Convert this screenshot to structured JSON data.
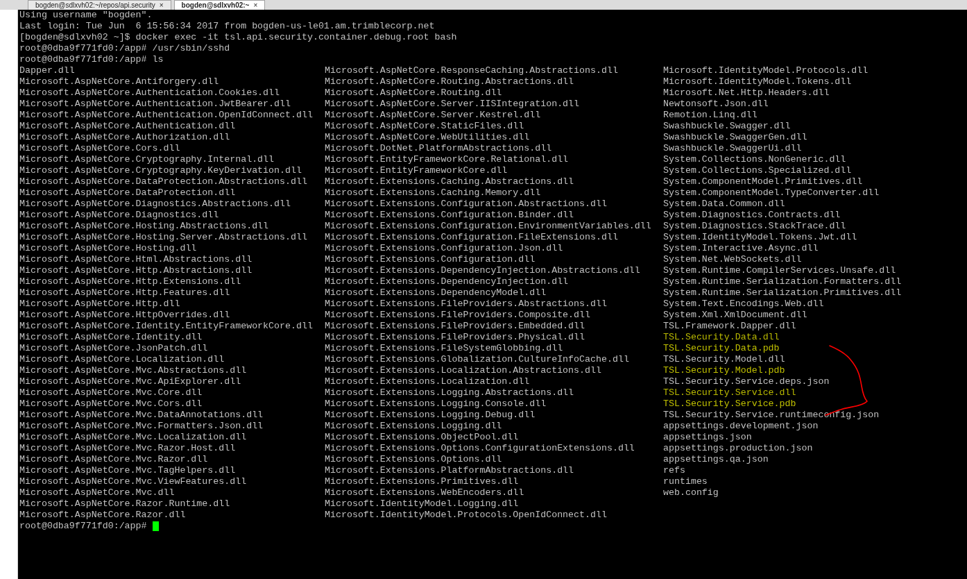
{
  "tabs": [
    {
      "label": "bogden@sdlxvh02:~/repos/api.security",
      "close": "×",
      "selected": false
    },
    {
      "label": "bogden@sdlxvh02:~",
      "close": "×",
      "selected": true
    }
  ],
  "terminal": {
    "lines": [
      "Using username \"bogden\".",
      "Last login: Tue Jun  6 15:56:34 2017 from bogden-us-le01.am.trimblecorp.net",
      "[bogden@sdlxvh02 ~]$ docker exec -it tsl.api.security.container.debug.root bash",
      "root@0dba9f771fd0:/app# /usr/sbin/sshd",
      "root@0dba9f771fd0:/app# ls"
    ],
    "listing": [
      [
        {
          "name": "Dapper.dll",
          "color": "#c0c0c0"
        },
        {
          "name": "Microsoft.AspNetCore.Antiforgery.dll",
          "color": "#c0c0c0"
        },
        {
          "name": "Microsoft.AspNetCore.Authentication.Cookies.dll",
          "color": "#c0c0c0"
        },
        {
          "name": "Microsoft.AspNetCore.Authentication.JwtBearer.dll",
          "color": "#c0c0c0"
        },
        {
          "name": "Microsoft.AspNetCore.Authentication.OpenIdConnect.dll",
          "color": "#c0c0c0"
        },
        {
          "name": "Microsoft.AspNetCore.Authentication.dll",
          "color": "#c0c0c0"
        },
        {
          "name": "Microsoft.AspNetCore.Authorization.dll",
          "color": "#c0c0c0"
        },
        {
          "name": "Microsoft.AspNetCore.Cors.dll",
          "color": "#c0c0c0"
        },
        {
          "name": "Microsoft.AspNetCore.Cryptography.Internal.dll",
          "color": "#c0c0c0"
        },
        {
          "name": "Microsoft.AspNetCore.Cryptography.KeyDerivation.dll",
          "color": "#c0c0c0"
        },
        {
          "name": "Microsoft.AspNetCore.DataProtection.Abstractions.dll",
          "color": "#c0c0c0"
        },
        {
          "name": "Microsoft.AspNetCore.DataProtection.dll",
          "color": "#c0c0c0"
        },
        {
          "name": "Microsoft.AspNetCore.Diagnostics.Abstractions.dll",
          "color": "#c0c0c0"
        },
        {
          "name": "Microsoft.AspNetCore.Diagnostics.dll",
          "color": "#c0c0c0"
        },
        {
          "name": "Microsoft.AspNetCore.Hosting.Abstractions.dll",
          "color": "#c0c0c0"
        },
        {
          "name": "Microsoft.AspNetCore.Hosting.Server.Abstractions.dll",
          "color": "#c0c0c0"
        },
        {
          "name": "Microsoft.AspNetCore.Hosting.dll",
          "color": "#c0c0c0"
        },
        {
          "name": "Microsoft.AspNetCore.Html.Abstractions.dll",
          "color": "#c0c0c0"
        },
        {
          "name": "Microsoft.AspNetCore.Http.Abstractions.dll",
          "color": "#c0c0c0"
        },
        {
          "name": "Microsoft.AspNetCore.Http.Extensions.dll",
          "color": "#c0c0c0"
        },
        {
          "name": "Microsoft.AspNetCore.Http.Features.dll",
          "color": "#c0c0c0"
        },
        {
          "name": "Microsoft.AspNetCore.Http.dll",
          "color": "#c0c0c0"
        },
        {
          "name": "Microsoft.AspNetCore.HttpOverrides.dll",
          "color": "#c0c0c0"
        },
        {
          "name": "Microsoft.AspNetCore.Identity.EntityFrameworkCore.dll",
          "color": "#c0c0c0"
        },
        {
          "name": "Microsoft.AspNetCore.Identity.dll",
          "color": "#c0c0c0"
        },
        {
          "name": "Microsoft.AspNetCore.JsonPatch.dll",
          "color": "#c0c0c0"
        },
        {
          "name": "Microsoft.AspNetCore.Localization.dll",
          "color": "#c0c0c0"
        },
        {
          "name": "Microsoft.AspNetCore.Mvc.Abstractions.dll",
          "color": "#c0c0c0"
        },
        {
          "name": "Microsoft.AspNetCore.Mvc.ApiExplorer.dll",
          "color": "#c0c0c0"
        },
        {
          "name": "Microsoft.AspNetCore.Mvc.Core.dll",
          "color": "#c0c0c0"
        },
        {
          "name": "Microsoft.AspNetCore.Mvc.Cors.dll",
          "color": "#c0c0c0"
        },
        {
          "name": "Microsoft.AspNetCore.Mvc.DataAnnotations.dll",
          "color": "#c0c0c0"
        },
        {
          "name": "Microsoft.AspNetCore.Mvc.Formatters.Json.dll",
          "color": "#c0c0c0"
        },
        {
          "name": "Microsoft.AspNetCore.Mvc.Localization.dll",
          "color": "#c0c0c0"
        },
        {
          "name": "Microsoft.AspNetCore.Mvc.Razor.Host.dll",
          "color": "#c0c0c0"
        },
        {
          "name": "Microsoft.AspNetCore.Mvc.Razor.dll",
          "color": "#c0c0c0"
        },
        {
          "name": "Microsoft.AspNetCore.Mvc.TagHelpers.dll",
          "color": "#c0c0c0"
        },
        {
          "name": "Microsoft.AspNetCore.Mvc.ViewFeatures.dll",
          "color": "#c0c0c0"
        },
        {
          "name": "Microsoft.AspNetCore.Mvc.dll",
          "color": "#c0c0c0"
        },
        {
          "name": "Microsoft.AspNetCore.Razor.Runtime.dll",
          "color": "#c0c0c0"
        },
        {
          "name": "Microsoft.AspNetCore.Razor.dll",
          "color": "#c0c0c0"
        }
      ],
      [
        {
          "name": "Microsoft.AspNetCore.ResponseCaching.Abstractions.dll",
          "color": "#c0c0c0"
        },
        {
          "name": "Microsoft.AspNetCore.Routing.Abstractions.dll",
          "color": "#c0c0c0"
        },
        {
          "name": "Microsoft.AspNetCore.Routing.dll",
          "color": "#c0c0c0"
        },
        {
          "name": "Microsoft.AspNetCore.Server.IISIntegration.dll",
          "color": "#c0c0c0"
        },
        {
          "name": "Microsoft.AspNetCore.Server.Kestrel.dll",
          "color": "#c0c0c0"
        },
        {
          "name": "Microsoft.AspNetCore.StaticFiles.dll",
          "color": "#c0c0c0"
        },
        {
          "name": "Microsoft.AspNetCore.WebUtilities.dll",
          "color": "#c0c0c0"
        },
        {
          "name": "Microsoft.DotNet.PlatformAbstractions.dll",
          "color": "#c0c0c0"
        },
        {
          "name": "Microsoft.EntityFrameworkCore.Relational.dll",
          "color": "#c0c0c0"
        },
        {
          "name": "Microsoft.EntityFrameworkCore.dll",
          "color": "#c0c0c0"
        },
        {
          "name": "Microsoft.Extensions.Caching.Abstractions.dll",
          "color": "#c0c0c0"
        },
        {
          "name": "Microsoft.Extensions.Caching.Memory.dll",
          "color": "#c0c0c0"
        },
        {
          "name": "Microsoft.Extensions.Configuration.Abstractions.dll",
          "color": "#c0c0c0"
        },
        {
          "name": "Microsoft.Extensions.Configuration.Binder.dll",
          "color": "#c0c0c0"
        },
        {
          "name": "Microsoft.Extensions.Configuration.EnvironmentVariables.dll",
          "color": "#c0c0c0"
        },
        {
          "name": "Microsoft.Extensions.Configuration.FileExtensions.dll",
          "color": "#c0c0c0"
        },
        {
          "name": "Microsoft.Extensions.Configuration.Json.dll",
          "color": "#c0c0c0"
        },
        {
          "name": "Microsoft.Extensions.Configuration.dll",
          "color": "#c0c0c0"
        },
        {
          "name": "Microsoft.Extensions.DependencyInjection.Abstractions.dll",
          "color": "#c0c0c0"
        },
        {
          "name": "Microsoft.Extensions.DependencyInjection.dll",
          "color": "#c0c0c0"
        },
        {
          "name": "Microsoft.Extensions.DependencyModel.dll",
          "color": "#c0c0c0"
        },
        {
          "name": "Microsoft.Extensions.FileProviders.Abstractions.dll",
          "color": "#c0c0c0"
        },
        {
          "name": "Microsoft.Extensions.FileProviders.Composite.dll",
          "color": "#c0c0c0"
        },
        {
          "name": "Microsoft.Extensions.FileProviders.Embedded.dll",
          "color": "#c0c0c0"
        },
        {
          "name": "Microsoft.Extensions.FileProviders.Physical.dll",
          "color": "#c0c0c0"
        },
        {
          "name": "Microsoft.Extensions.FileSystemGlobbing.dll",
          "color": "#c0c0c0"
        },
        {
          "name": "Microsoft.Extensions.Globalization.CultureInfoCache.dll",
          "color": "#c0c0c0"
        },
        {
          "name": "Microsoft.Extensions.Localization.Abstractions.dll",
          "color": "#c0c0c0"
        },
        {
          "name": "Microsoft.Extensions.Localization.dll",
          "color": "#c0c0c0"
        },
        {
          "name": "Microsoft.Extensions.Logging.Abstractions.dll",
          "color": "#c0c0c0"
        },
        {
          "name": "Microsoft.Extensions.Logging.Console.dll",
          "color": "#c0c0c0"
        },
        {
          "name": "Microsoft.Extensions.Logging.Debug.dll",
          "color": "#c0c0c0"
        },
        {
          "name": "Microsoft.Extensions.Logging.dll",
          "color": "#c0c0c0"
        },
        {
          "name": "Microsoft.Extensions.ObjectPool.dll",
          "color": "#c0c0c0"
        },
        {
          "name": "Microsoft.Extensions.Options.ConfigurationExtensions.dll",
          "color": "#c0c0c0"
        },
        {
          "name": "Microsoft.Extensions.Options.dll",
          "color": "#c0c0c0"
        },
        {
          "name": "Microsoft.Extensions.PlatformAbstractions.dll",
          "color": "#c0c0c0"
        },
        {
          "name": "Microsoft.Extensions.Primitives.dll",
          "color": "#c0c0c0"
        },
        {
          "name": "Microsoft.Extensions.WebEncoders.dll",
          "color": "#c0c0c0"
        },
        {
          "name": "Microsoft.IdentityModel.Logging.dll",
          "color": "#c0c0c0"
        },
        {
          "name": "Microsoft.IdentityModel.Protocols.OpenIdConnect.dll",
          "color": "#c0c0c0"
        }
      ],
      [
        {
          "name": "Microsoft.IdentityModel.Protocols.dll",
          "color": "#c0c0c0"
        },
        {
          "name": "Microsoft.IdentityModel.Tokens.dll",
          "color": "#c0c0c0"
        },
        {
          "name": "Microsoft.Net.Http.Headers.dll",
          "color": "#c0c0c0"
        },
        {
          "name": "Newtonsoft.Json.dll",
          "color": "#c0c0c0"
        },
        {
          "name": "Remotion.Linq.dll",
          "color": "#c0c0c0"
        },
        {
          "name": "Swashbuckle.Swagger.dll",
          "color": "#c0c0c0"
        },
        {
          "name": "Swashbuckle.SwaggerGen.dll",
          "color": "#c0c0c0"
        },
        {
          "name": "Swashbuckle.SwaggerUi.dll",
          "color": "#c0c0c0"
        },
        {
          "name": "System.Collections.NonGeneric.dll",
          "color": "#c0c0c0"
        },
        {
          "name": "System.Collections.Specialized.dll",
          "color": "#c0c0c0"
        },
        {
          "name": "System.ComponentModel.Primitives.dll",
          "color": "#c0c0c0"
        },
        {
          "name": "System.ComponentModel.TypeConverter.dll",
          "color": "#c0c0c0"
        },
        {
          "name": "System.Data.Common.dll",
          "color": "#c0c0c0"
        },
        {
          "name": "System.Diagnostics.Contracts.dll",
          "color": "#c0c0c0"
        },
        {
          "name": "System.Diagnostics.StackTrace.dll",
          "color": "#c0c0c0"
        },
        {
          "name": "System.IdentityModel.Tokens.Jwt.dll",
          "color": "#c0c0c0"
        },
        {
          "name": "System.Interactive.Async.dll",
          "color": "#c0c0c0"
        },
        {
          "name": "System.Net.WebSockets.dll",
          "color": "#c0c0c0"
        },
        {
          "name": "System.Runtime.CompilerServices.Unsafe.dll",
          "color": "#c0c0c0"
        },
        {
          "name": "System.Runtime.Serialization.Formatters.dll",
          "color": "#c0c0c0"
        },
        {
          "name": "System.Runtime.Serialization.Primitives.dll",
          "color": "#c0c0c0"
        },
        {
          "name": "System.Text.Encodings.Web.dll",
          "color": "#c0c0c0"
        },
        {
          "name": "System.Xml.XmlDocument.dll",
          "color": "#c0c0c0"
        },
        {
          "name": "TSL.Framework.Dapper.dll",
          "color": "#c0c0c0"
        },
        {
          "name": "TSL.Security.Data.dll",
          "color": "#b8b800"
        },
        {
          "name": "TSL.Security.Data.pdb",
          "color": "#c0c000"
        },
        {
          "name": "TSL.Security.Model.dll",
          "color": "#c0c0c0"
        },
        {
          "name": "TSL.Security.Model.pdb",
          "color": "#c0c000"
        },
        {
          "name": "TSL.Security.Service.deps.json",
          "color": "#c0c0c0"
        },
        {
          "name": "TSL.Security.Service.dll",
          "color": "#b8b800"
        },
        {
          "name": "TSL.Security.Service.pdb",
          "color": "#c0c000"
        },
        {
          "name": "TSL.Security.Service.runtimeconfig.json",
          "color": "#c0c0c0"
        },
        {
          "name": "appsettings.development.json",
          "color": "#c0c0c0"
        },
        {
          "name": "appsettings.json",
          "color": "#c0c0c0"
        },
        {
          "name": "appsettings.production.json",
          "color": "#c0c0c0"
        },
        {
          "name": "appsettings.qa.json",
          "color": "#c0c0c0"
        },
        {
          "name": "refs",
          "color": "#c0c0c0"
        },
        {
          "name": "runtimes",
          "color": "#c0c0c0"
        },
        {
          "name": "web.config",
          "color": "#c0c0c0"
        }
      ]
    ],
    "prompt": "root@0dba9f771fd0:/app#"
  }
}
